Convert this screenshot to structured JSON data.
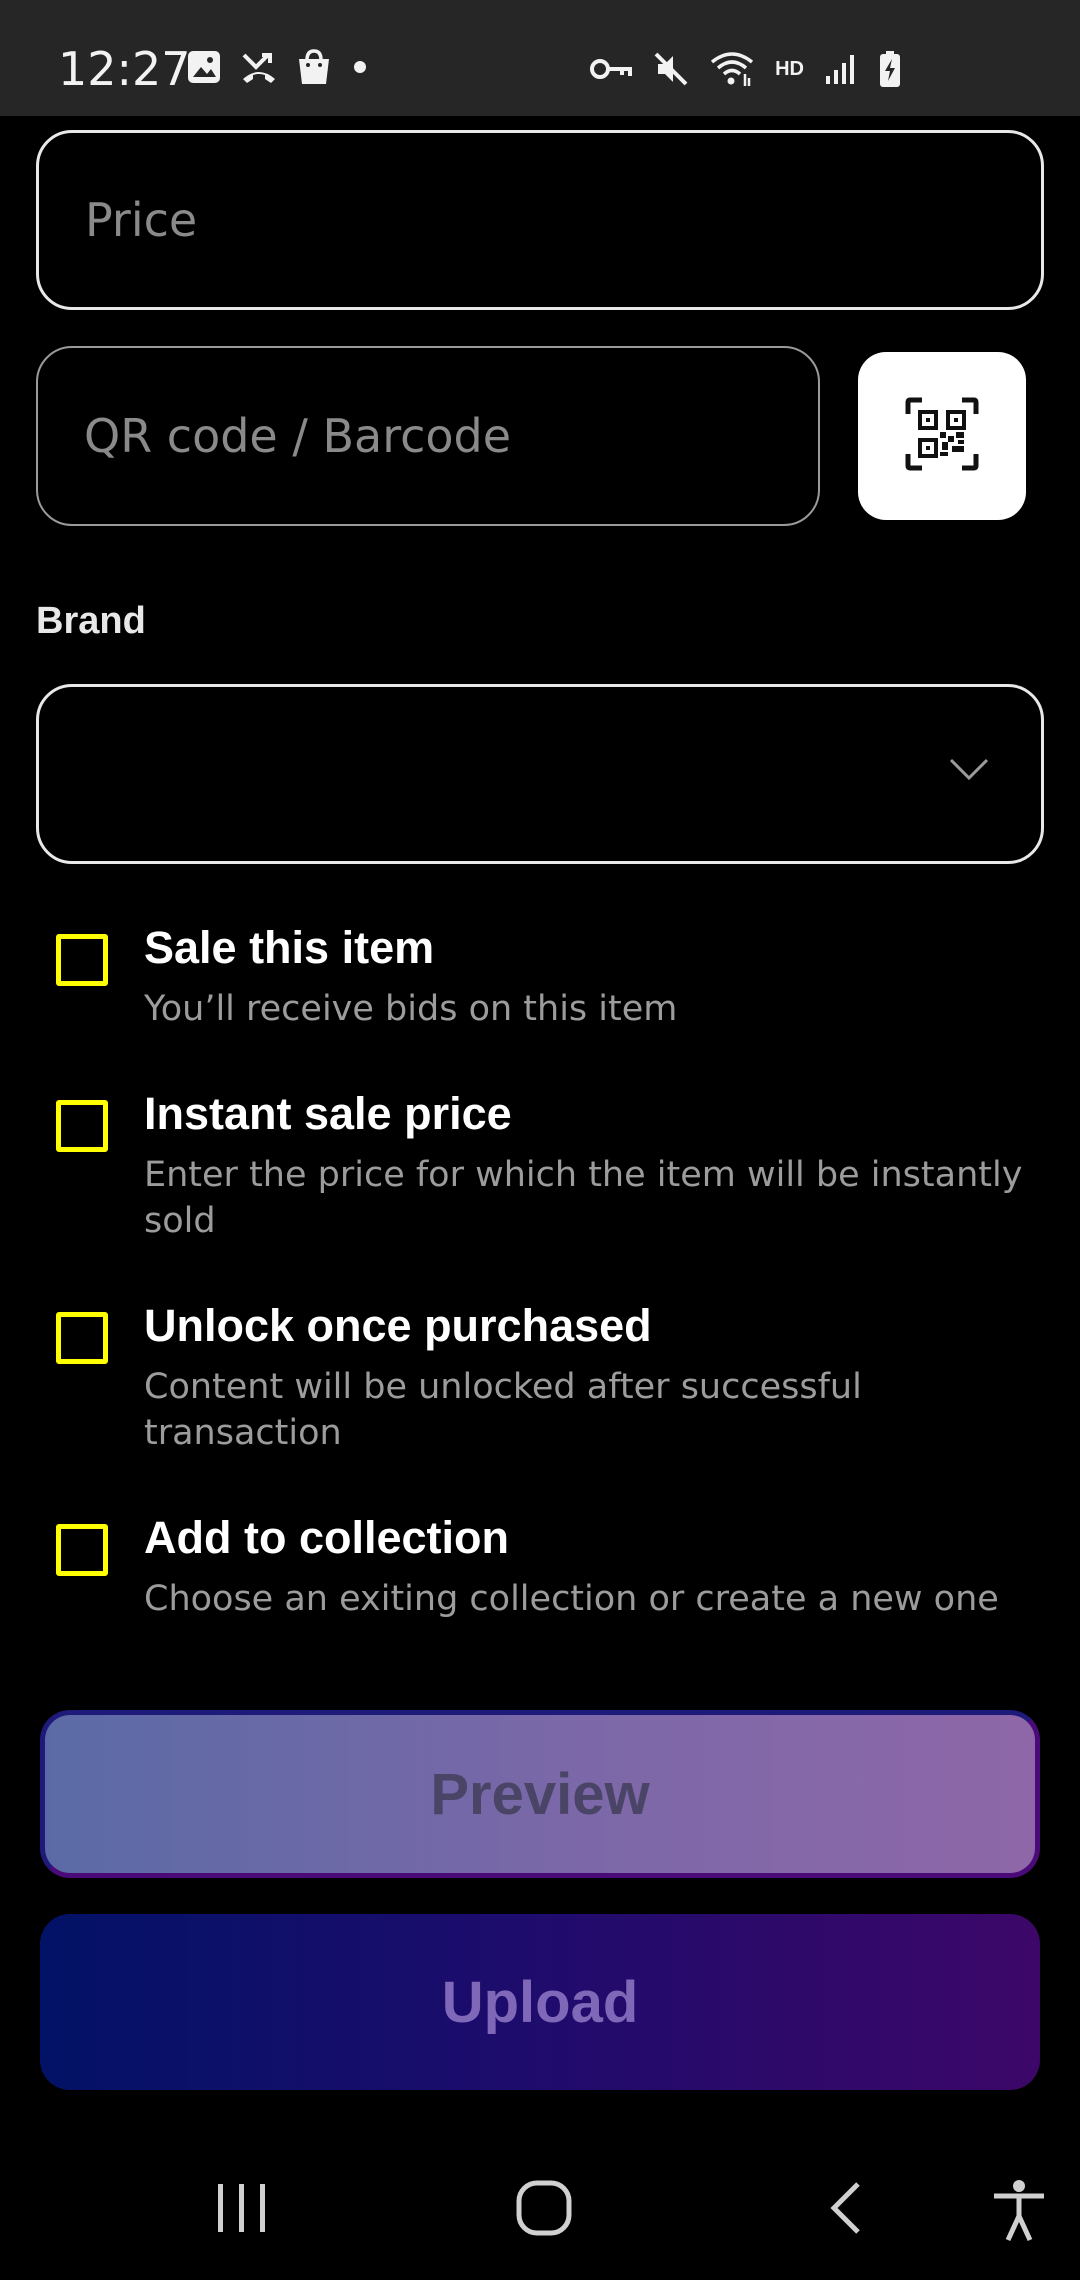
{
  "status_bar": {
    "time": "12:27",
    "hd": "HD",
    "left_icons": [
      "gallery-icon",
      "missed-call-icon",
      "shopping-bag-icon",
      "dot-icon"
    ],
    "right_icons": [
      "key-icon",
      "mute-icon",
      "wifi-icon",
      "signal-icon",
      "battery-charging-icon"
    ]
  },
  "form": {
    "price_placeholder": "Price",
    "qr_placeholder": "QR code / Barcode",
    "brand_label": "Brand",
    "brand_value": ""
  },
  "options": [
    {
      "title": "Sale this item",
      "description": "You’ll receive bids on this item",
      "checked": false
    },
    {
      "title": "Instant sale price",
      "description": "Enter the price for which the item will be instantly sold",
      "checked": false
    },
    {
      "title": "Unlock once purchased",
      "description": "Content will be unlocked after successful transaction",
      "checked": false
    },
    {
      "title": "Add to collection",
      "description": "Choose an exiting collection or create a new one",
      "checked": false
    }
  ],
  "buttons": {
    "preview": "Preview",
    "upload": "Upload"
  },
  "colors": {
    "checkbox": "#ffff00",
    "preview_gradient": [
      "#5b6aa6",
      "#8e67a8"
    ],
    "upload_gradient": [
      "#021266",
      "#3c0769"
    ]
  },
  "nav_bar": [
    "recent-apps-icon",
    "home-icon",
    "back-icon",
    "accessibility-icon"
  ]
}
